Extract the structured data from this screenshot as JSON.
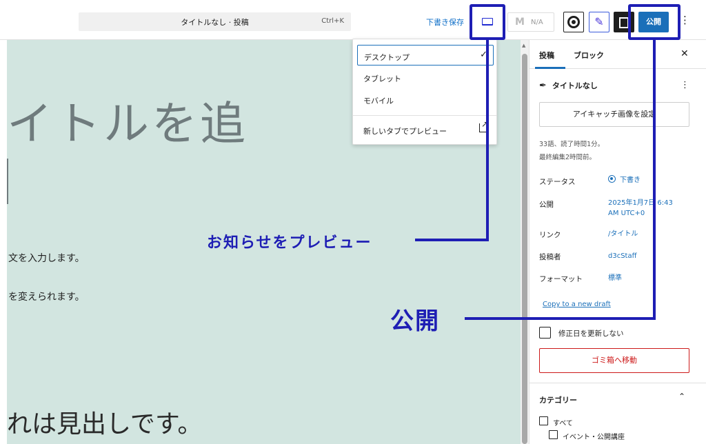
{
  "topbar": {
    "command_title": "タイトルなし · 投稿",
    "command_shortcut": "Ctrl+K",
    "save_draft": "下書き保存",
    "na_label": "N/A",
    "publish": "公開"
  },
  "preview_menu": {
    "items": [
      {
        "label": "デスクトップ",
        "selected": true
      },
      {
        "label": "タブレット",
        "selected": false
      },
      {
        "label": "モバイル",
        "selected": false
      }
    ],
    "checkmark": "✓",
    "new_tab": "新しいタブでプレビュー"
  },
  "editor": {
    "title_fragment": "イトルを追",
    "paragraph1": "文を入力します。",
    "paragraph2": "を変えられます。",
    "heading": "れは見出しです。"
  },
  "sidebar": {
    "tabs": [
      "投稿",
      "ブロック"
    ],
    "close": "✕",
    "post_title": "タイトルなし",
    "featured_image": "アイキャッチ画像を設定",
    "word_count": "33語、読了時間1分。",
    "last_edited": "最終編集2時間前。",
    "status_label": "ステータス",
    "status_value": "下書き",
    "publish_label": "公開",
    "publish_value": "2025年1月7日 6:43 AM UTC+0",
    "link_label": "リンク",
    "link_value": "/タイトル",
    "author_label": "投稿者",
    "author_value": "d3cStaff",
    "format_label": "フォーマット",
    "format_value": "標準",
    "copy_draft": "Copy to a new draft",
    "no_update_date": "修正日を更新しない",
    "trash": "ゴミ箱へ移動",
    "categories_title": "カテゴリー",
    "categories": [
      "すべて",
      "イベント・公開講座"
    ]
  },
  "annotations": {
    "preview_note": "お知らせをプレビュー",
    "publish_note": "公開"
  },
  "colors": {
    "annotation": "#1e1eb4",
    "accent": "#1a6fb9",
    "canvas": "#d2e5e0",
    "danger": "#cc1818"
  }
}
